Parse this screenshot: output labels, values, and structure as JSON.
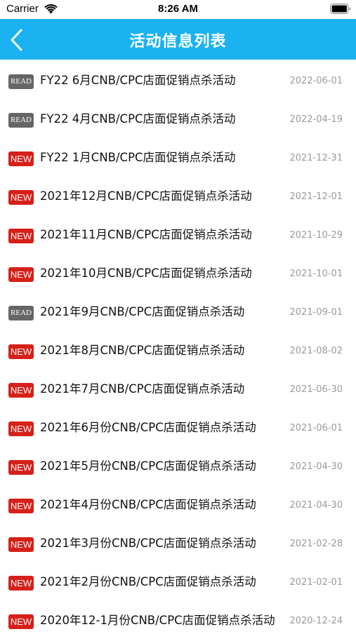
{
  "status_bar": {
    "carrier": "Carrier",
    "time": "8:26 AM",
    "wifi_icon": "wifi-icon",
    "battery_icon": "battery-icon"
  },
  "nav": {
    "title": "活动信息列表",
    "back_icon": "chevron-left-icon",
    "background": "#1ab2f0"
  },
  "colors": {
    "new_badge": "#d62019",
    "read_badge": "#666666",
    "date_text": "#9a9a9a"
  },
  "items": [
    {
      "badge": "READ",
      "title": "FY22 6月CNB/CPC店面促销点杀活动",
      "date": "2022-06-01"
    },
    {
      "badge": "READ",
      "title": "FY22 4月CNB/CPC店面促销点杀活动",
      "date": "2022-04-19"
    },
    {
      "badge": "NEW",
      "title": "FY22 1月CNB/CPC店面促销点杀活动",
      "date": "2021-12-31"
    },
    {
      "badge": "NEW",
      "title": "2021年12月CNB/CPC店面促销点杀活动",
      "date": "2021-12-01"
    },
    {
      "badge": "NEW",
      "title": "2021年11月CNB/CPC店面促销点杀活动",
      "date": "2021-10-29"
    },
    {
      "badge": "NEW",
      "title": "2021年10月CNB/CPC店面促销点杀活动",
      "date": "2021-10-01"
    },
    {
      "badge": "READ",
      "title": "2021年9月CNB/CPC店面促销点杀活动",
      "date": "2021-09-01"
    },
    {
      "badge": "NEW",
      "title": "2021年8月CNB/CPC店面促销点杀活动",
      "date": "2021-08-02"
    },
    {
      "badge": "NEW",
      "title": "2021年7月CNB/CPC店面促销点杀活动",
      "date": "2021-06-30"
    },
    {
      "badge": "NEW",
      "title": "2021年6月份CNB/CPC店面促销点杀活动",
      "date": "2021-06-01"
    },
    {
      "badge": "NEW",
      "title": "2021年5月份CNB/CPC店面促销点杀活动",
      "date": "2021-04-30"
    },
    {
      "badge": "NEW",
      "title": "2021年4月份CNB/CPC店面促销点杀活动",
      "date": "2021-04-30"
    },
    {
      "badge": "NEW",
      "title": "2021年3月份CNB/CPC店面促销点杀活动",
      "date": "2021-02-28"
    },
    {
      "badge": "NEW",
      "title": "2021年2月份CNB/CPC店面促销点杀活动",
      "date": "2021-02-01"
    },
    {
      "badge": "NEW",
      "title": "2020年12-1月份CNB/CPC店面促销点杀活动",
      "date": "2020-12-24"
    }
  ]
}
